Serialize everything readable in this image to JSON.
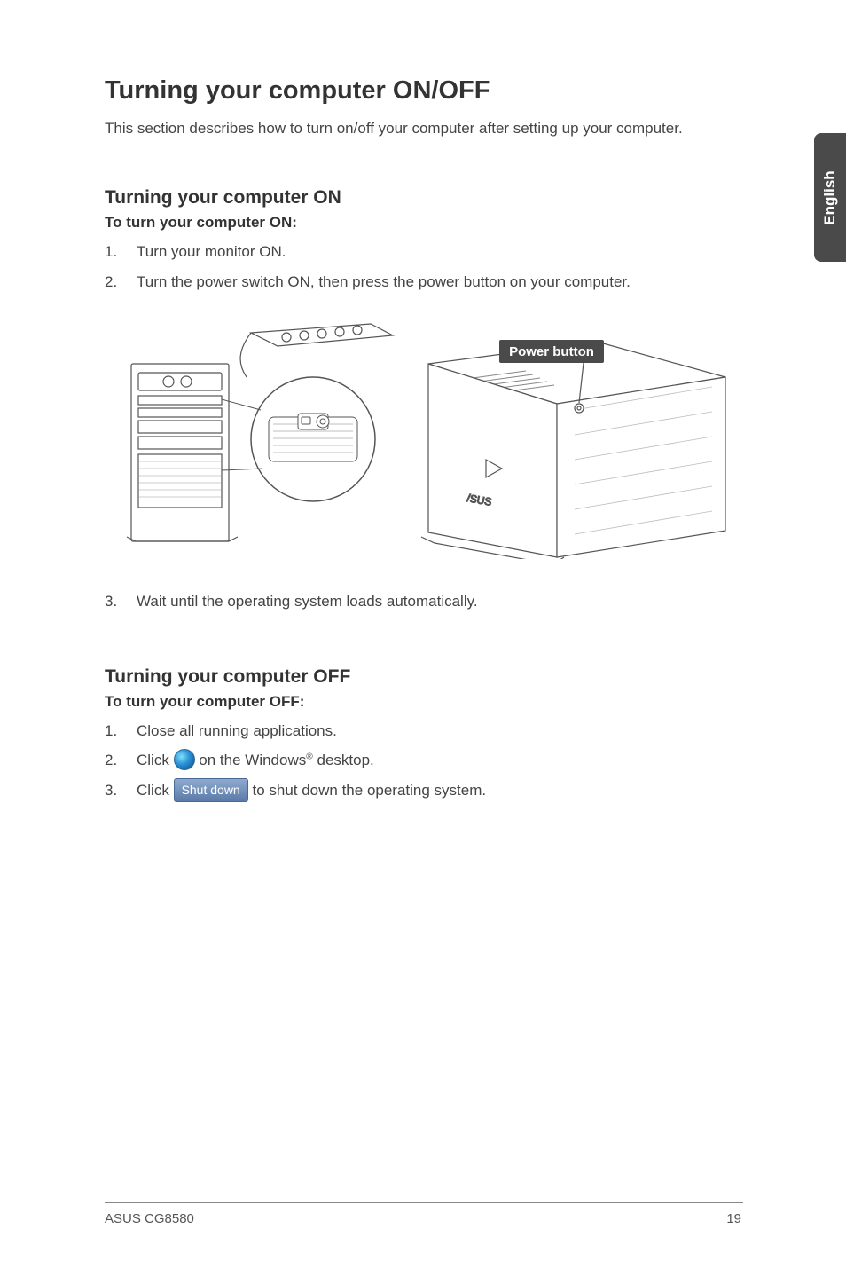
{
  "side_tab": {
    "label": "English"
  },
  "title": "Turning your computer ON/OFF",
  "intro": "This section describes how to turn on/off your computer after setting up your computer.",
  "section_on": {
    "heading": "Turning your computer ON",
    "subhead": "To turn your computer ON:",
    "steps": {
      "1": {
        "num": "1.",
        "text": "Turn your monitor ON."
      },
      "2": {
        "num": "2.",
        "text": "Turn the power switch ON, then press the power button on your computer."
      },
      "3": {
        "num": "3.",
        "text": "Wait until the operating system loads automatically."
      }
    },
    "diagram": {
      "label_power_button": "Power button"
    }
  },
  "section_off": {
    "heading": "Turning your computer OFF",
    "subhead": "To turn your computer OFF:",
    "steps": {
      "1": {
        "num": "1.",
        "text": "Close all running applications."
      },
      "2": {
        "num": "2.",
        "prefix": "Click ",
        "mid": " on the Windows",
        "sup": "®",
        "suffix": " desktop."
      },
      "3": {
        "num": "3.",
        "prefix": "Click ",
        "btn": "Shut down",
        "suffix": " to shut down the operating system."
      }
    }
  },
  "footer": {
    "left": "ASUS CG8580",
    "right": "19"
  }
}
